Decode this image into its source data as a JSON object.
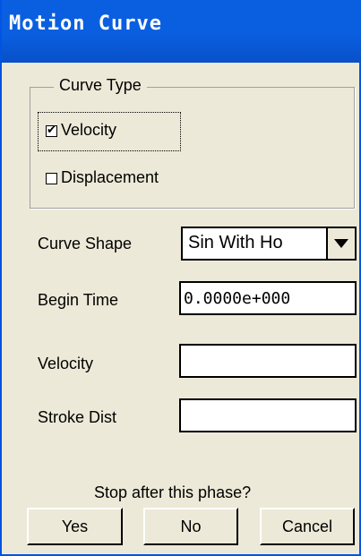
{
  "window": {
    "title": "Motion Curve"
  },
  "curve_type": {
    "group_title": "Curve Type",
    "options": [
      {
        "label": "Velocity",
        "checked": true
      },
      {
        "label": "Displacement",
        "checked": false
      }
    ]
  },
  "curve_shape": {
    "label": "Curve Shape",
    "value": "Sin With Ho"
  },
  "begin_time": {
    "label": "Begin Time",
    "value": "0.0000e+000"
  },
  "velocity": {
    "label": "Velocity",
    "value": ""
  },
  "stroke_dist": {
    "label": "Stroke Dist",
    "value": ""
  },
  "prompt": "Stop after this phase?",
  "buttons": {
    "yes": "Yes",
    "no": "No",
    "cancel": "Cancel"
  },
  "colors": {
    "titlebar": "#0a5fe0",
    "dialog_bg": "#ece9d8"
  }
}
